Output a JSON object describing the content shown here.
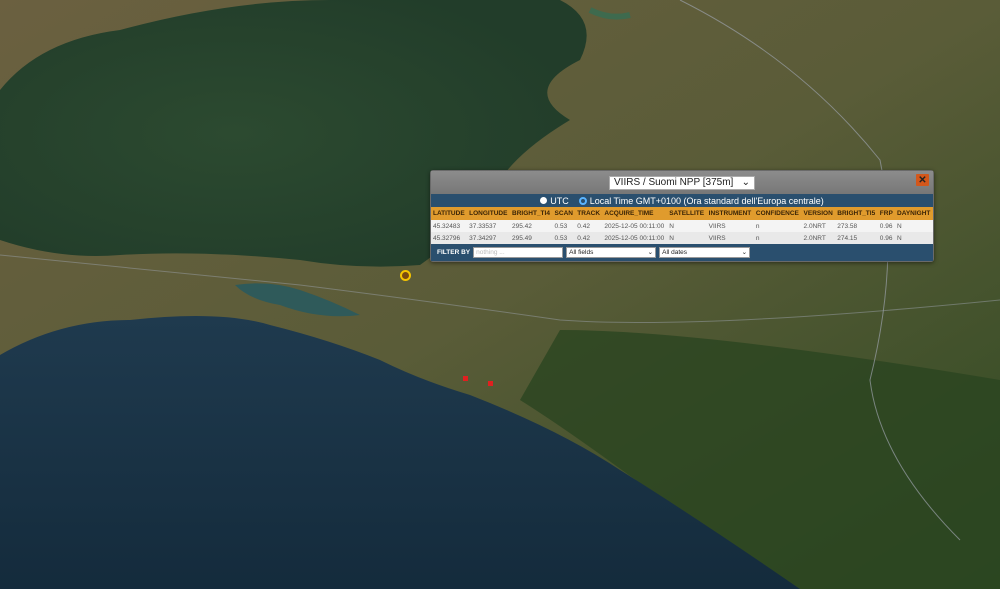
{
  "popup": {
    "satellite_select": "VIIRS / Suomi NPP [375m]",
    "close_label": "✕",
    "tz_utc": "UTC",
    "tz_local": "Local Time GMT+0100 (Ora standard dell'Europa centrale)",
    "columns": [
      "LATITUDE",
      "LONGITUDE",
      "BRIGHT_TI4",
      "SCAN",
      "TRACK",
      "ACQUIRE_TIME",
      "SATELLITE",
      "INSTRUMENT",
      "CONFIDENCE",
      "VERSION",
      "BRIGHT_TI5",
      "FRP",
      "DAYNIGHT"
    ],
    "rows": [
      [
        "45.32483",
        "37.33537",
        "295.42",
        "0.53",
        "0.42",
        "2025-12-05 00:11:00",
        "N",
        "VIIRS",
        "n",
        "2.0NRT",
        "273.58",
        "0.96",
        "N"
      ],
      [
        "45.32796",
        "37.34297",
        "295.49",
        "0.53",
        "0.42",
        "2025-12-05 00:11:00",
        "N",
        "VIIRS",
        "n",
        "2.0NRT",
        "274.15",
        "0.96",
        "N"
      ]
    ],
    "filter_label": "FILTER BY",
    "filter_placeholder": "nothing ...",
    "field_select": "All fields",
    "date_select": "All dates"
  },
  "colors": {
    "header": "#e09b2d",
    "band": "#2a4f6e",
    "marker": "#f5c400",
    "fire": "#e02020"
  }
}
